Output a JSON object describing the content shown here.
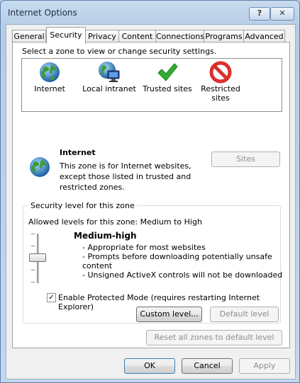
{
  "window": {
    "title": "Internet Options",
    "help_label": "?",
    "close_label": "✕"
  },
  "tabs": [
    {
      "label": "General"
    },
    {
      "label": "Security"
    },
    {
      "label": "Privacy"
    },
    {
      "label": "Content"
    },
    {
      "label": "Connections"
    },
    {
      "label": "Programs"
    },
    {
      "label": "Advanced"
    }
  ],
  "security": {
    "instruction": "Select a zone to view or change security settings.",
    "zones": [
      {
        "label": "Internet",
        "icon": "globe-icon"
      },
      {
        "label": "Local intranet",
        "icon": "intranet-icon"
      },
      {
        "label": "Trusted sites",
        "icon": "checkmark-icon"
      },
      {
        "label": "Restricted sites",
        "icon": "restricted-icon"
      }
    ],
    "selected_zone": {
      "name": "Internet",
      "desc": [
        "This zone is for Internet websites,",
        "except those listed in trusted and",
        "restricted zones."
      ]
    },
    "sites_button": "Sites",
    "level_group": {
      "title": "Security level for this zone",
      "allowed": "Allowed levels for this zone: Medium to High",
      "level_name": "Medium-high",
      "level_desc": [
        "- Appropriate for most websites",
        "- Prompts before downloading potentially unsafe",
        "content",
        "- Unsigned ActiveX controls will not be downloaded"
      ],
      "protected_mode_label": "Enable Protected Mode (requires restarting Internet Explorer)",
      "protected_mode_checked": "✓",
      "custom_level_button": "Custom level...",
      "default_level_button": "Default level"
    },
    "reset_all_button": "Reset all zones to default level"
  },
  "footer": {
    "ok": "OK",
    "cancel": "Cancel",
    "apply": "Apply"
  },
  "colors": {
    "accent": "#3c7fb1",
    "check_green": "#2fae2f",
    "restricted_red": "#d9302c"
  }
}
